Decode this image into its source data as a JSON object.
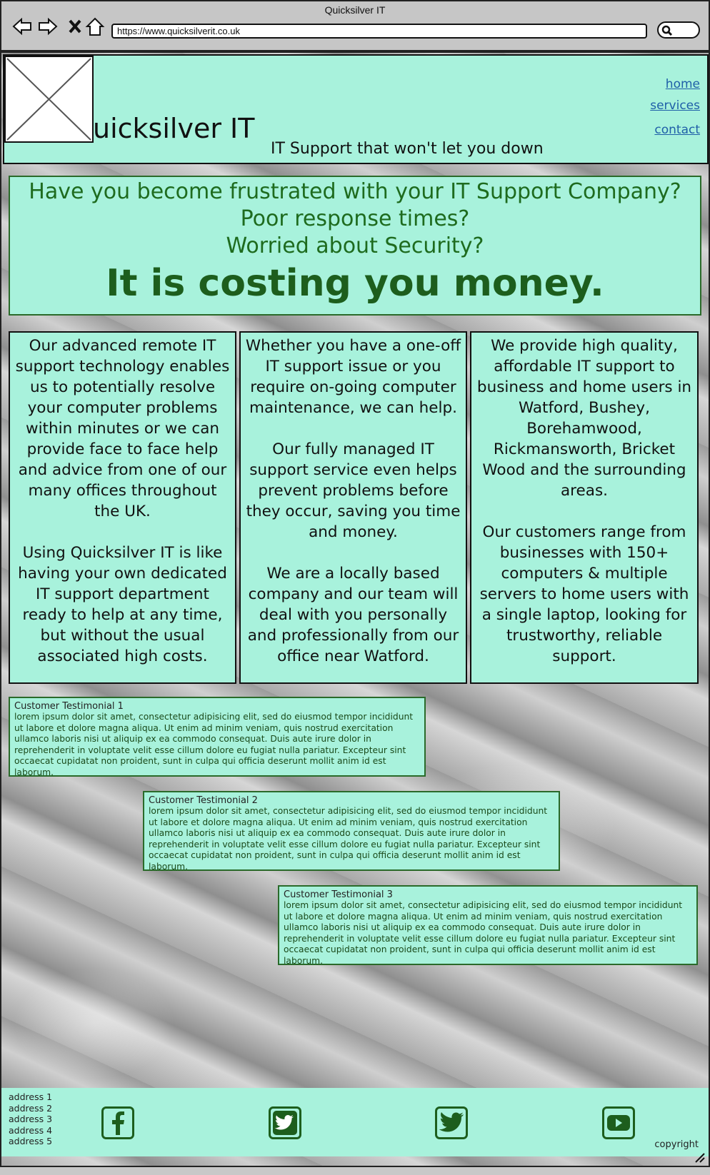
{
  "browser": {
    "title": "Quicksilver IT",
    "url": "https://www.quicksilverit.co.uk"
  },
  "header": {
    "brand": "uicksilver IT",
    "tagline": "IT Support that won't let you down",
    "nav": [
      "home",
      "services",
      "contact"
    ]
  },
  "hero": {
    "lines": [
      "Have you become frustrated with your IT Support Company?",
      "Poor response times?",
      "Worried about Security?"
    ],
    "headline": "It is costing you money."
  },
  "columns": [
    {
      "paragraphs": [
        "Our advanced remote IT support technology enables us to potentially resolve your computer problems within minutes or we can provide face to face help and advice from one of our many offices throughout the UK.",
        "Using Quicksilver IT is like having your own dedicated IT support department ready to help at any time, but without the usual associated high costs."
      ]
    },
    {
      "paragraphs": [
        "Whether you have a one-off IT support issue or you require on-going computer maintenance, we can help.",
        "Our fully managed IT support service even helps prevent problems before they occur, saving you time and money.",
        "We are a locally based company and our team will deal with you personally and professionally from our office near Watford."
      ]
    },
    {
      "paragraphs": [
        "We provide high quality, affordable IT support to business and home users in Watford, Bushey, Borehamwood, Rickmansworth, Bricket Wood and the surrounding areas.",
        "Our customers range from businesses with 150+ computers & multiple servers to home users with a single laptop, looking for trustworthy, reliable support."
      ]
    }
  ],
  "testimonials": [
    {
      "title": "Customer Testimonial 1",
      "body": "lorem ipsum dolor sit amet, consectetur adipisicing elit, sed do eiusmod tempor incididunt ut labore et dolore magna aliqua. Ut enim ad minim veniam, quis nostrud exercitation ullamco laboris nisi ut aliquip ex ea commodo consequat. Duis aute irure dolor in reprehenderit in voluptate velit esse cillum dolore eu fugiat nulla pariatur. Excepteur sint occaecat cupidatat non proident, sunt in culpa qui officia deserunt mollit anim id est laborum."
    },
    {
      "title": "Customer Testimonial 2",
      "body": "lorem ipsum dolor sit amet, consectetur adipisicing elit, sed do eiusmod tempor incididunt ut labore et dolore magna aliqua. Ut enim ad minim veniam, quis nostrud exercitation ullamco laboris nisi ut aliquip ex ea commodo consequat. Duis aute irure dolor in reprehenderit in voluptate velit esse cillum dolore eu fugiat nulla pariatur. Excepteur sint occaecat cupidatat non proident, sunt in culpa qui officia deserunt mollit anim id est laborum."
    },
    {
      "title": "Customer Testimonial 3",
      "body": "lorem ipsum dolor sit amet, consectetur adipisicing elit, sed do eiusmod tempor incididunt ut labore et dolore magna aliqua. Ut enim ad minim veniam, quis nostrud exercitation ullamco laboris nisi ut aliquip ex ea commodo consequat. Duis aute irure dolor in reprehenderit in voluptate velit esse cillum dolore eu fugiat nulla pariatur. Excepteur sint occaecat cupidatat non proident, sunt in culpa qui officia deserunt mollit anim id est laborum."
    }
  ],
  "footer": {
    "addresses": [
      "address 1",
      "address 2",
      "address 3",
      "address 4",
      "address 5"
    ],
    "social": [
      "facebook-icon",
      "twitter-icon",
      "twitter-bird-icon",
      "youtube-icon"
    ],
    "copyright": "copyright"
  },
  "colors": {
    "panel": "#a8f2dc",
    "hero_text": "#1e6b1e",
    "link": "#1f5fa8"
  }
}
